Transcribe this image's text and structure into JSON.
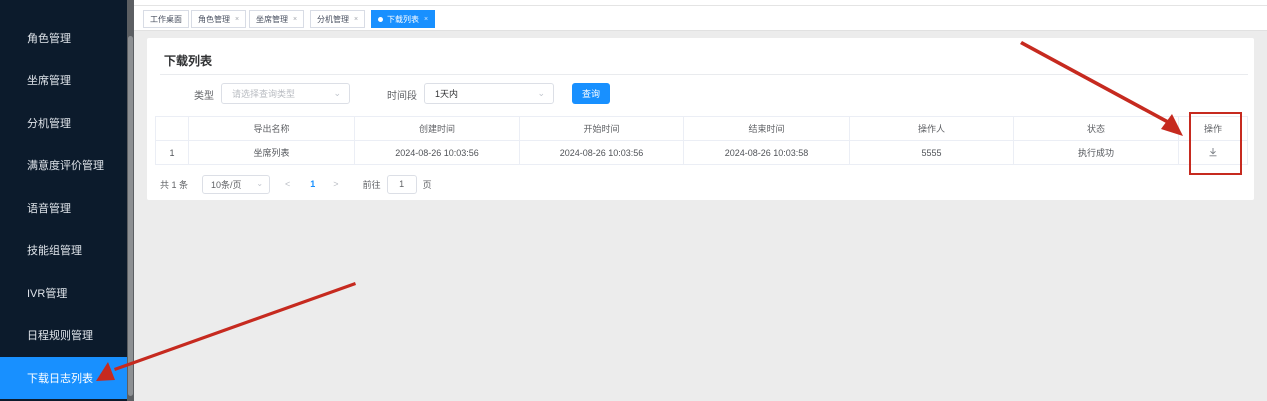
{
  "sidebar": {
    "items": [
      {
        "label": "角色管理",
        "active": false
      },
      {
        "label": "坐席管理",
        "active": false
      },
      {
        "label": "分机管理",
        "active": false
      },
      {
        "label": "满意度评价管理",
        "active": false
      },
      {
        "label": "语音管理",
        "active": false
      },
      {
        "label": "技能组管理",
        "active": false
      },
      {
        "label": "IVR管理",
        "active": false
      },
      {
        "label": "日程规则管理",
        "active": false
      },
      {
        "label": "下载日志列表",
        "active": true
      }
    ]
  },
  "tabs": [
    {
      "label": "工作桌面",
      "closable": false
    },
    {
      "label": "角色管理",
      "closable": true
    },
    {
      "label": "坐席管理",
      "closable": true
    },
    {
      "label": "分机管理",
      "closable": true
    },
    {
      "label": "下载列表",
      "closable": true,
      "active": true
    }
  ],
  "tab_close_glyph": "×",
  "page": {
    "title": "下载列表",
    "filters": {
      "type_label": "类型",
      "type_placeholder": "请选择查询类型",
      "period_label": "时间段",
      "period_value": "1天内",
      "query_button": "查询"
    }
  },
  "table": {
    "columns": [
      "",
      "导出名称",
      "创建时间",
      "开始时间",
      "结束时间",
      "操作人",
      "状态",
      "操作"
    ],
    "rows": [
      [
        "1",
        "坐席列表",
        "2024-08-26 10:03:56",
        "2024-08-26 10:03:56",
        "2024-08-26 10:03:58",
        "5555",
        "执行成功"
      ]
    ],
    "action_icon": "download-icon"
  },
  "pagination": {
    "total_text": "共 1 条",
    "page_size": "10条/页",
    "prev": "<",
    "current_page": "1",
    "next": ">",
    "goto_label": "前往",
    "goto_value": "1",
    "goto_suffix": "页"
  },
  "colors": {
    "accent": "#1890ff",
    "sidebar_bg": "#0c1b2c",
    "annotation_red": "#c62a1f"
  }
}
